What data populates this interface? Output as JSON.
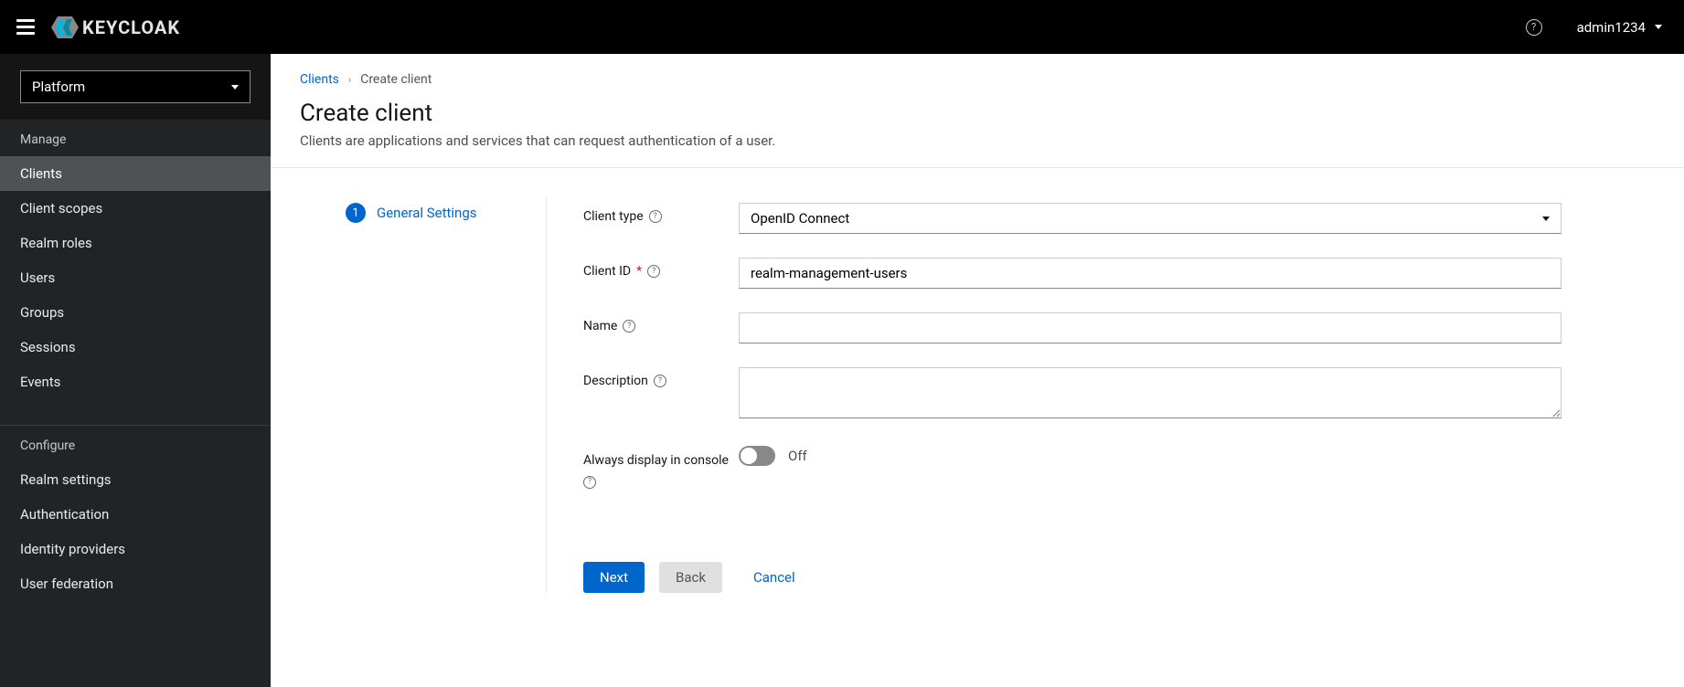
{
  "header": {
    "brand_text": "KEYCLOAK",
    "username": "admin1234"
  },
  "sidebar": {
    "realm_name": "Platform",
    "sections": [
      {
        "title": "Manage",
        "items": [
          "Clients",
          "Client scopes",
          "Realm roles",
          "Users",
          "Groups",
          "Sessions",
          "Events"
        ],
        "active_index": 0
      },
      {
        "title": "Configure",
        "items": [
          "Realm settings",
          "Authentication",
          "Identity providers",
          "User federation"
        ]
      }
    ]
  },
  "breadcrumb": {
    "parent": "Clients",
    "current": "Create client"
  },
  "page": {
    "title": "Create client",
    "description": "Clients are applications and services that can request authentication of a user."
  },
  "wizard": {
    "step_number": "1",
    "step_label": "General Settings"
  },
  "form": {
    "client_type_label": "Client type",
    "client_type_value": "OpenID Connect",
    "client_id_label": "Client ID",
    "client_id_value": "realm-management-users",
    "name_label": "Name",
    "name_value": "",
    "description_label": "Description",
    "description_value": "",
    "always_display_label": "Always display in console",
    "always_display_value": "Off"
  },
  "buttons": {
    "next": "Next",
    "back": "Back",
    "cancel": "Cancel"
  }
}
